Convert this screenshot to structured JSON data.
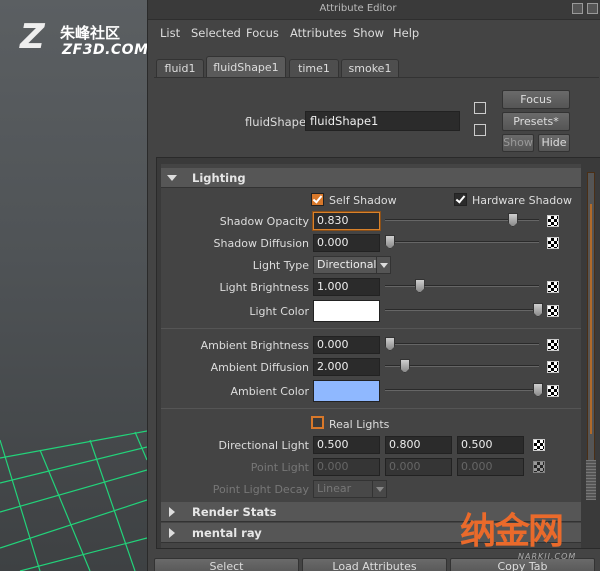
{
  "window": {
    "title": "Attribute Editor"
  },
  "watermark_top": {
    "logo_letter": "Z",
    "cn": "朱峰社区",
    "en": "ZF3D.COM"
  },
  "watermark_bottom": {
    "cn": "纳金网",
    "en": "NARKII.COM"
  },
  "menu": [
    "List",
    "Selected",
    "Focus",
    "Attributes",
    "Show",
    "Help"
  ],
  "tabs": [
    {
      "label": "fluid1",
      "active": false
    },
    {
      "label": "fluidShape1",
      "active": true
    },
    {
      "label": "time1",
      "active": false
    },
    {
      "label": "smoke1",
      "active": false
    }
  ],
  "node": {
    "label": "fluidShape:",
    "value": "fluidShape1"
  },
  "buttons": {
    "focus": "Focus",
    "presets": "Presets*",
    "show": "Show",
    "hide": "Hide"
  },
  "lighting": {
    "header": "Lighting",
    "self_shadow": {
      "label": "Self Shadow",
      "checked": true
    },
    "hardware_shadow": {
      "label": "Hardware Shadow",
      "checked": true
    },
    "shadow_opacity": {
      "label": "Shadow Opacity",
      "value": "0.830",
      "slider": 0.83
    },
    "shadow_diffusion": {
      "label": "Shadow Diffusion",
      "value": "0.000",
      "slider": 0.0
    },
    "light_type": {
      "label": "Light Type",
      "value": "Directional"
    },
    "light_brightness": {
      "label": "Light Brightness",
      "value": "1.000",
      "slider": 0.2
    },
    "light_color": {
      "label": "Light Color",
      "color": "#ffffff",
      "slider": 1.0
    },
    "ambient_brightness": {
      "label": "Ambient Brightness",
      "value": "0.000",
      "slider": 0.0
    },
    "ambient_diffusion": {
      "label": "Ambient Diffusion",
      "value": "2.000",
      "slider": 0.1
    },
    "ambient_color": {
      "label": "Ambient Color",
      "color": "#8fb8ff",
      "slider": 1.0
    },
    "real_lights": {
      "label": "Real Lights",
      "checked": false
    },
    "directional_light": {
      "label": "Directional Light",
      "values": [
        "0.500",
        "0.800",
        "0.500"
      ]
    },
    "point_light": {
      "label": "Point Light",
      "values": [
        "0.000",
        "0.000",
        "0.000"
      ]
    },
    "point_light_decay": {
      "label": "Point Light Decay",
      "value": "Linear"
    }
  },
  "collapsed_sections": [
    "Render Stats",
    "mental ray"
  ],
  "bottom_buttons": [
    "Select",
    "Load Attributes",
    "Copy Tab"
  ],
  "colors": {
    "accent": "#d8782a",
    "viewport_grid": "#22d37a"
  }
}
